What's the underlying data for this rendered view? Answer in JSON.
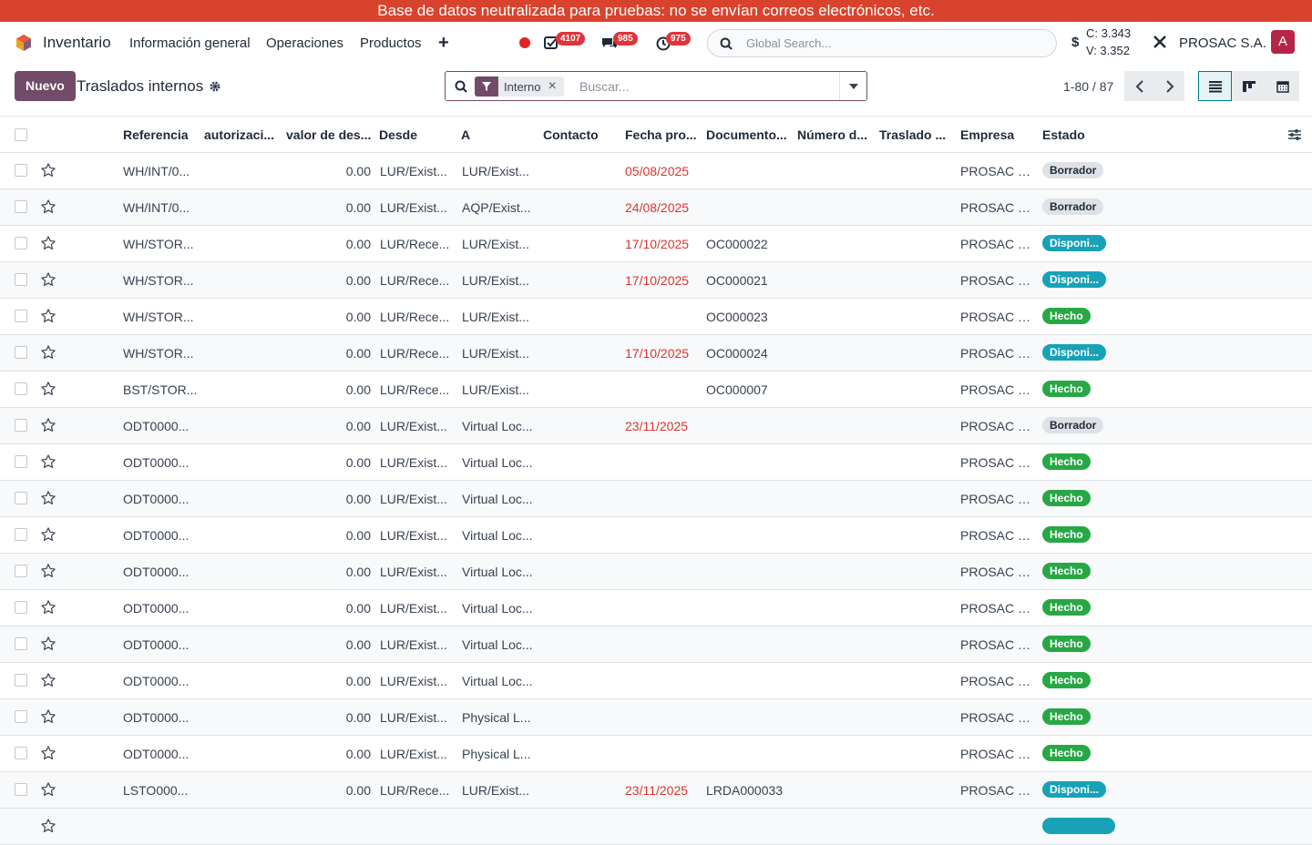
{
  "banner": "Base de datos neutralizada para pruebas: no se envían correos electrónicos, etc.",
  "nav": {
    "app_name": "Inventario",
    "menus": [
      "Información general",
      "Operaciones",
      "Productos"
    ],
    "plus": "+",
    "badges": {
      "activities": "4107",
      "messages": "985",
      "timers": "975"
    },
    "global_search_placeholder": "Global Search...",
    "currency": "$",
    "rate_c": "C: 3.343",
    "rate_v": "V: 3.352",
    "company": "PROSAC S.A.",
    "avatar": "A"
  },
  "control": {
    "new_button": "Nuevo",
    "title": "Traslados internos",
    "facet": "Interno",
    "search_placeholder": "Buscar...",
    "pager": "1-80 / 87"
  },
  "columns": [
    "Referencia",
    "autorizaci...",
    "valor de des...",
    "Desde",
    "A",
    "Contacto",
    "Fecha pro...",
    "Documento...",
    "Número d...",
    "Traslado ...",
    "Empresa",
    "Estado"
  ],
  "rows": [
    {
      "ref": "WH/INT/0...",
      "valor": "0.00",
      "desde": "LUR/Exist...",
      "a": "LUR/Exist...",
      "fecha": "05/08/2025",
      "doc": "",
      "empresa": "PROSAC S...",
      "estado": "Borrador",
      "kind": "borrador"
    },
    {
      "ref": "WH/INT/0...",
      "valor": "0.00",
      "desde": "LUR/Exist...",
      "a": "AQP/Exist...",
      "fecha": "24/08/2025",
      "doc": "",
      "empresa": "PROSAC S...",
      "estado": "Borrador",
      "kind": "borrador"
    },
    {
      "ref": "WH/STOR...",
      "valor": "0.00",
      "desde": "LUR/Rece...",
      "a": "LUR/Exist...",
      "fecha": "17/10/2025",
      "doc": "OC000022",
      "empresa": "PROSAC S...",
      "estado": "Disponi...",
      "kind": "disp"
    },
    {
      "ref": "WH/STOR...",
      "valor": "0.00",
      "desde": "LUR/Rece...",
      "a": "LUR/Exist...",
      "fecha": "17/10/2025",
      "doc": "OC000021",
      "empresa": "PROSAC S...",
      "estado": "Disponi...",
      "kind": "disp"
    },
    {
      "ref": "WH/STOR...",
      "valor": "0.00",
      "desde": "LUR/Rece...",
      "a": "LUR/Exist...",
      "fecha": "",
      "doc": "OC000023",
      "empresa": "PROSAC S...",
      "estado": "Hecho",
      "kind": "hecho"
    },
    {
      "ref": "WH/STOR...",
      "valor": "0.00",
      "desde": "LUR/Rece...",
      "a": "LUR/Exist...",
      "fecha": "17/10/2025",
      "doc": "OC000024",
      "empresa": "PROSAC S...",
      "estado": "Disponi...",
      "kind": "disp"
    },
    {
      "ref": "BST/STOR...",
      "valor": "0.00",
      "desde": "LUR/Rece...",
      "a": "LUR/Exist...",
      "fecha": "",
      "doc": "OC000007",
      "empresa": "PROSAC S...",
      "estado": "Hecho",
      "kind": "hecho"
    },
    {
      "ref": "ODT0000...",
      "valor": "0.00",
      "desde": "LUR/Exist...",
      "a": "Virtual Loc...",
      "fecha": "23/11/2025",
      "doc": "",
      "empresa": "PROSAC S...",
      "estado": "Borrador",
      "kind": "borrador"
    },
    {
      "ref": "ODT0000...",
      "valor": "0.00",
      "desde": "LUR/Exist...",
      "a": "Virtual Loc...",
      "fecha": "",
      "doc": "",
      "empresa": "PROSAC S...",
      "estado": "Hecho",
      "kind": "hecho"
    },
    {
      "ref": "ODT0000...",
      "valor": "0.00",
      "desde": "LUR/Exist...",
      "a": "Virtual Loc...",
      "fecha": "",
      "doc": "",
      "empresa": "PROSAC S...",
      "estado": "Hecho",
      "kind": "hecho"
    },
    {
      "ref": "ODT0000...",
      "valor": "0.00",
      "desde": "LUR/Exist...",
      "a": "Virtual Loc...",
      "fecha": "",
      "doc": "",
      "empresa": "PROSAC S...",
      "estado": "Hecho",
      "kind": "hecho"
    },
    {
      "ref": "ODT0000...",
      "valor": "0.00",
      "desde": "LUR/Exist...",
      "a": "Virtual Loc...",
      "fecha": "",
      "doc": "",
      "empresa": "PROSAC S...",
      "estado": "Hecho",
      "kind": "hecho"
    },
    {
      "ref": "ODT0000...",
      "valor": "0.00",
      "desde": "LUR/Exist...",
      "a": "Virtual Loc...",
      "fecha": "",
      "doc": "",
      "empresa": "PROSAC S...",
      "estado": "Hecho",
      "kind": "hecho"
    },
    {
      "ref": "ODT0000...",
      "valor": "0.00",
      "desde": "LUR/Exist...",
      "a": "Virtual Loc...",
      "fecha": "",
      "doc": "",
      "empresa": "PROSAC S...",
      "estado": "Hecho",
      "kind": "hecho"
    },
    {
      "ref": "ODT0000...",
      "valor": "0.00",
      "desde": "LUR/Exist...",
      "a": "Virtual Loc...",
      "fecha": "",
      "doc": "",
      "empresa": "PROSAC S...",
      "estado": "Hecho",
      "kind": "hecho"
    },
    {
      "ref": "ODT0000...",
      "valor": "0.00",
      "desde": "LUR/Exist...",
      "a": "Physical L...",
      "fecha": "",
      "doc": "",
      "empresa": "PROSAC S...",
      "estado": "Hecho",
      "kind": "hecho"
    },
    {
      "ref": "ODT0000...",
      "valor": "0.00",
      "desde": "LUR/Exist...",
      "a": "Physical L...",
      "fecha": "",
      "doc": "",
      "empresa": "PROSAC S...",
      "estado": "Hecho",
      "kind": "hecho"
    },
    {
      "ref": "LSTO000...",
      "valor": "0.00",
      "desde": "LUR/Rece...",
      "a": "LUR/Exist...",
      "fecha": "23/11/2025",
      "doc": "LRDA000033",
      "empresa": "PROSAC S...",
      "estado": "Disponi...",
      "kind": "disp"
    }
  ],
  "colors": {
    "banner": "#d9432d",
    "brand": "#714b67",
    "overdue": "#d9342b",
    "hecho": "#28a745",
    "disponible": "#17a2b8",
    "borrador": "#dee2e6"
  }
}
